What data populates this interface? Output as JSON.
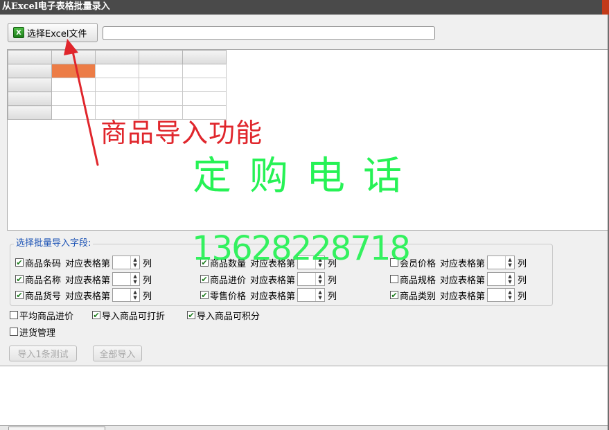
{
  "window": {
    "title": "从Excel电子表格批量录入"
  },
  "toolbar": {
    "select_button_label": "选择Excel文件",
    "file_path_value": "",
    "excel_icon_glyph": "X"
  },
  "annotations": {
    "red_caption": "商品导入功能",
    "phone_label": "定购电话",
    "phone_number": "13628228718",
    "red_color": "#e0262c",
    "green_color": "#26f255"
  },
  "grid": {
    "selected_cell_color": "#ec7c46"
  },
  "fieldset": {
    "legend": "选择批量导入字段:",
    "fields": [
      {
        "name": "商品条码",
        "checked": true,
        "sub": "对应表格第",
        "value": "",
        "suffix": "列"
      },
      {
        "name": "商品名称",
        "checked": true,
        "sub": "对应表格第",
        "value": "",
        "suffix": "列"
      },
      {
        "name": "商品货号",
        "checked": true,
        "sub": "对应表格第",
        "value": "",
        "suffix": "列"
      },
      {
        "name": "商品数量",
        "checked": true,
        "sub": "对应表格第",
        "value": "",
        "suffix": "列"
      },
      {
        "name": "商品进价",
        "checked": true,
        "sub": "对应表格第",
        "value": "",
        "suffix": "列"
      },
      {
        "name": "零售价格",
        "checked": true,
        "sub": "对应表格第",
        "value": "",
        "suffix": "列"
      },
      {
        "name": "会员价格",
        "checked": false,
        "sub": "对应表格第",
        "value": "",
        "suffix": "列"
      },
      {
        "name": "商品规格",
        "checked": false,
        "sub": "对应表格第",
        "value": "",
        "suffix": "列"
      },
      {
        "name": "商品类别",
        "checked": true,
        "sub": "对应表格第",
        "value": "",
        "suffix": "列"
      }
    ]
  },
  "options": [
    {
      "label": "平均商品进价",
      "checked": false
    },
    {
      "label": "导入商品可打折",
      "checked": true
    },
    {
      "label": "导入商品可积分",
      "checked": true
    },
    {
      "label": "进货管理",
      "checked": false
    }
  ],
  "actions": {
    "test_import_label": "导入1条测试",
    "import_all_label": "全部导入"
  }
}
